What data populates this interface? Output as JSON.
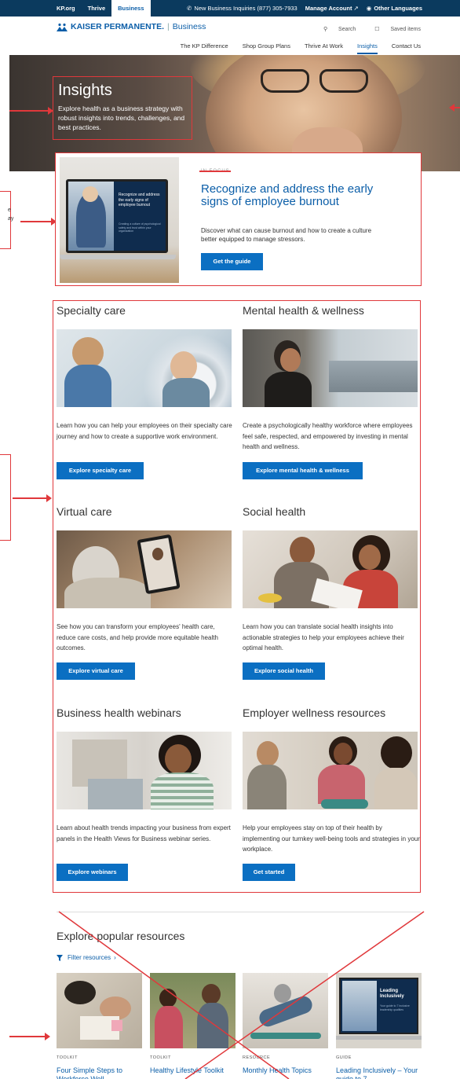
{
  "utility_bar": {
    "links": [
      "KP.org",
      "Thrive",
      "Business"
    ],
    "active": "Business",
    "inquiries": "New Business Inquiries (877) 305-7933",
    "manage_account": "Manage Account",
    "other_languages": "Other Languages"
  },
  "header": {
    "brand": "KAISER PERMANENTE.",
    "brand_sub": "Business",
    "search_label": "Search",
    "saved_label": "Saved items"
  },
  "main_nav": {
    "items": [
      "The KP Difference",
      "Shop Group Plans",
      "Thrive At Work",
      "Insights",
      "Contact Us"
    ],
    "active": "Insights"
  },
  "hero": {
    "title": "Insights",
    "description": "Explore health as a business strategy with robust insights into trends, challenges, and best practices."
  },
  "side_labels": {
    "left_fragment_1": "e",
    "left_fragment_2": "ay"
  },
  "in_focus": {
    "eyebrow": "IN FOCUS",
    "title": "Recognize and address the early signs of employee burnout",
    "description": "Discover what can cause burnout and how to create a culture better equipped to manage stressors.",
    "button": "Get the guide",
    "laptop_heading": "Recognize and address the early signs of employee burnout",
    "laptop_subtext": "Creating a culture of psychological safety and trust within your organization"
  },
  "categories": [
    {
      "title": "Specialty care",
      "description": "Learn how you can help your employees on their specialty care journey and how to create a supportive work environment.",
      "button": "Explore specialty care"
    },
    {
      "title": "Mental health & wellness",
      "description": "Create a psychologically healthy workforce where employees feel safe, respected, and empowered by investing in mental health and wellness.",
      "button": "Explore mental health & wellness"
    },
    {
      "title": "Virtual care",
      "description": "See how you can transform your employees' health care, reduce care costs, and help provide more equitable health outcomes.",
      "button": "Explore virtual care"
    },
    {
      "title": "Social health",
      "description": "Learn how you can translate social health insights into actionable strategies to help your employees achieve their optimal health.",
      "button": "Explore social health"
    },
    {
      "title": "Business health webinars",
      "description": "Learn about health trends impacting your business from expert panels in the Health Views for Business webinar series.",
      "button": "Explore webinars"
    },
    {
      "title": "Employer wellness resources",
      "description": "Help your employees stay on top of their health by implementing our turnkey well-being tools and strategies in your workplace.",
      "button": "Get started"
    }
  ],
  "resources": {
    "title": "Explore popular resources",
    "filter_label": "Filter resources",
    "cards": [
      {
        "tag": "TOOLKIT",
        "title": "Four Simple Steps to Workforce Well..."
      },
      {
        "tag": "TOOLKIT",
        "title": "Healthy Lifestyle Toolkit"
      },
      {
        "tag": "RESOURCE",
        "title": "Monthly Health Topics"
      },
      {
        "tag": "GUIDE",
        "title": "Leading Inclusively – Your guide to 7..."
      }
    ],
    "guide_image_title": "Leading Inclusively",
    "guide_image_sub": "Your guide to 7 inclusive leadership qualities"
  },
  "colors": {
    "utility_bg": "#0b3a5e",
    "brand_blue": "#0b5ea8",
    "button_blue": "#0b6fc2",
    "annotation_red": "#e0383b"
  }
}
